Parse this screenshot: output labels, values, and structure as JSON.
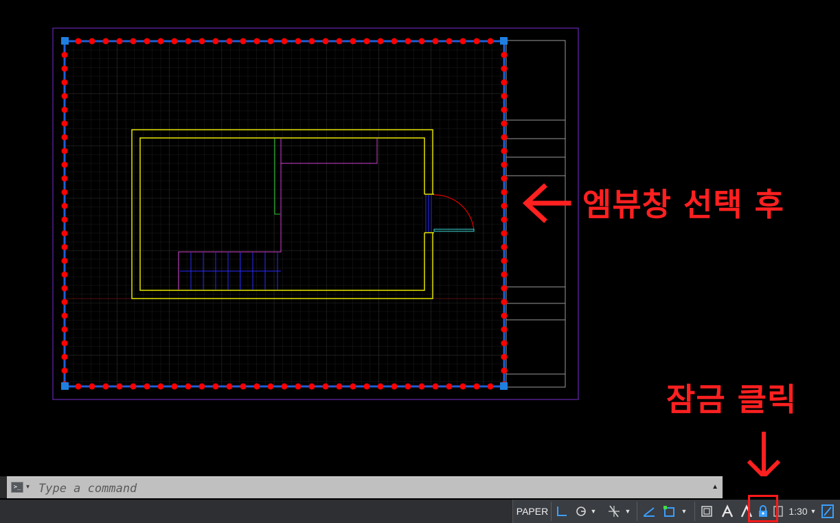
{
  "annotations": {
    "viewport_note": "엠뷰창 선택 후",
    "lock_note": "잠금 클릭"
  },
  "command_line": {
    "placeholder": "Type a command",
    "prompt_icon": ">_"
  },
  "status_bar": {
    "space": "PAPER",
    "scale": "1:30",
    "icons": [
      "ortho-icon",
      "polar-icon",
      "osnap-tracking-icon",
      "isodraft-icon",
      "dynamic-ucs-icon",
      "viewport-maximize-icon",
      "annotation-visibility-icon",
      "auto-scale-icon",
      "viewport-lock-icon",
      "viewport-scale-icon",
      "quick-properties-icon"
    ]
  },
  "colors": {
    "annotation": "#ff2020",
    "layout_border": "#7a2fd6",
    "viewport_edge": "#1e5fd9",
    "grips": "#ff0000",
    "walls": "#e6e600",
    "stairs": "#2a2aff",
    "partition": "#d040d0",
    "door_arc": "#e00000",
    "door_panel": "#40e0e0"
  }
}
